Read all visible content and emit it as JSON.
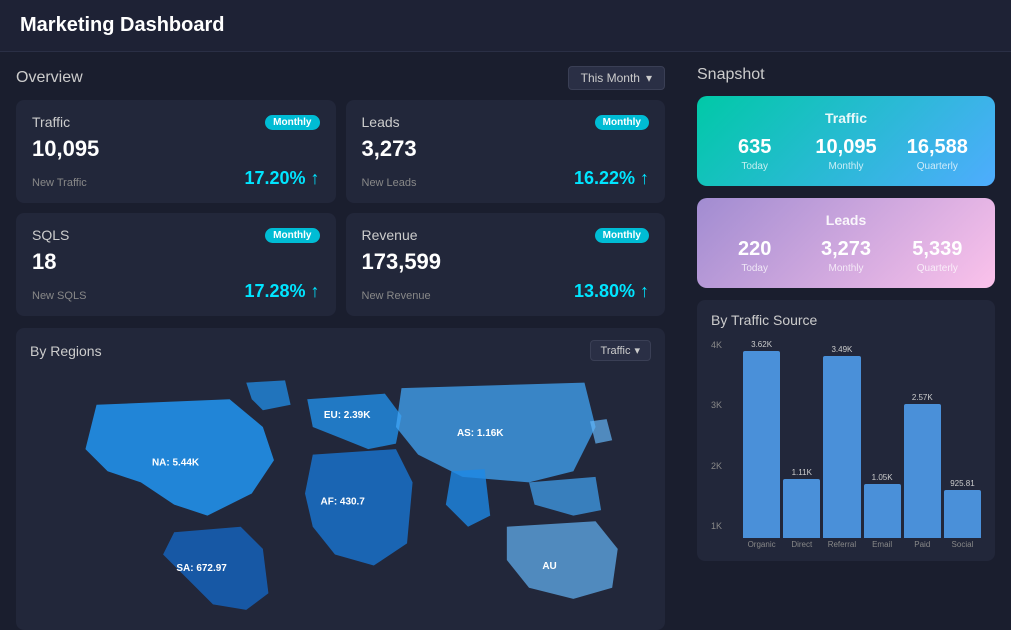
{
  "header": {
    "title": "Marketing Dashboard"
  },
  "overview": {
    "title": "Overview",
    "filter_label": "This Month",
    "cards": [
      {
        "id": "traffic",
        "title": "Traffic",
        "badge": "Monthly",
        "value": "10,095",
        "label": "New Traffic",
        "change": "17.20% ↑"
      },
      {
        "id": "leads",
        "title": "Leads",
        "badge": "Monthly",
        "value": "3,273",
        "label": "New Leads",
        "change": "16.22% ↑"
      },
      {
        "id": "sqls",
        "title": "SQLS",
        "badge": "Monthly",
        "value": "18",
        "label": "New SQLS",
        "change": "17.28% ↑"
      },
      {
        "id": "revenue",
        "title": "Revenue",
        "badge": "Monthly",
        "value": "173,599",
        "label": "New Revenue",
        "change": "13.80% ↑"
      }
    ]
  },
  "snapshot": {
    "title": "Snapshot",
    "traffic": {
      "label": "Traffic",
      "today": "635",
      "today_label": "Today",
      "monthly": "10,095",
      "monthly_label": "Monthly",
      "quarterly": "16,588",
      "quarterly_label": "Quarterly"
    },
    "leads": {
      "label": "Leads",
      "today": "220",
      "today_label": "Today",
      "monthly": "3,273",
      "monthly_label": "Monthly",
      "quarterly": "5,339",
      "quarterly_label": "Quarterly"
    }
  },
  "regions": {
    "title": "By Regions",
    "filter_label": "Traffic",
    "labels": [
      {
        "id": "na",
        "text": "NA: 5.44K"
      },
      {
        "id": "eu",
        "text": "EU: 2.39K"
      },
      {
        "id": "as",
        "text": "AS: 1.16K"
      },
      {
        "id": "af",
        "text": "AF: 430.7"
      },
      {
        "id": "sa",
        "text": "SA: 672.97"
      },
      {
        "id": "au",
        "text": "AU"
      }
    ]
  },
  "traffic_source": {
    "title": "By Traffic Source",
    "y_labels": [
      "4K",
      "3K",
      "2K",
      "1K"
    ],
    "bars": [
      {
        "label": "Organic",
        "value": 3620,
        "display": "3.62K",
        "height_pct": 90
      },
      {
        "label": "Direct",
        "value": 1110,
        "display": "1.11K",
        "height_pct": 28
      },
      {
        "label": "Referral",
        "value": 3490,
        "display": "3.49K",
        "height_pct": 87
      },
      {
        "label": "Email",
        "value": 1050,
        "display": "1.05K",
        "height_pct": 26
      },
      {
        "label": "Paid",
        "value": 2570,
        "display": "2.57K",
        "height_pct": 64
      },
      {
        "label": "Social",
        "value": 925.81,
        "display": "925.81",
        "height_pct": 23
      }
    ]
  },
  "icons": {
    "chevron_down": "▾",
    "arrow_up": "↑"
  }
}
